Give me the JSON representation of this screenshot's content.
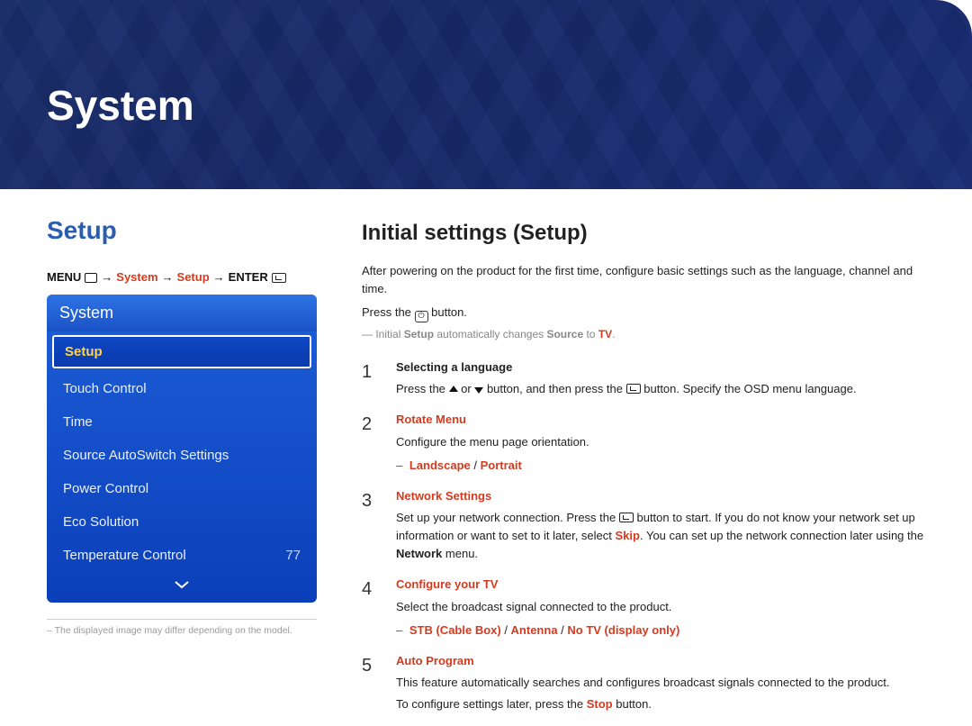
{
  "header": {
    "title": "System"
  },
  "left": {
    "setup_title": "Setup",
    "breadcrumb": {
      "menu": "MENU",
      "arrow": "→",
      "system": "System",
      "setup": "Setup",
      "enter": "ENTER"
    },
    "menu": {
      "title": "System",
      "items": [
        {
          "label": "Setup",
          "selected": true
        },
        {
          "label": "Touch Control"
        },
        {
          "label": "Time"
        },
        {
          "label": "Source AutoSwitch Settings"
        },
        {
          "label": "Power Control"
        },
        {
          "label": "Eco Solution"
        },
        {
          "label": "Temperature Control",
          "value": "77"
        }
      ]
    },
    "footnote_prefix": "– ",
    "footnote": "The displayed image may differ depending on the model."
  },
  "right": {
    "title": "Initial settings (Setup)",
    "intro": "After powering on the product for the first time, configure basic settings such as the language, channel and time.",
    "press_prefix": "Press the ",
    "press_suffix": " button.",
    "dash": "―",
    "dash_note_parts": {
      "t1": "Initial ",
      "setup": "Setup",
      "t2": " automatically changes ",
      "source": "Source",
      "t3": " to ",
      "tv": "TV",
      "t4": "."
    },
    "steps": [
      {
        "num": "1",
        "heading": "Selecting a language",
        "heading_red": false,
        "body_parts": {
          "p1": "Press the ",
          "p2": " or ",
          "p3": " button, and then press the ",
          "p4": " button. Specify the OSD menu language."
        }
      },
      {
        "num": "2",
        "heading": "Rotate Menu",
        "heading_red": true,
        "body": "Configure the menu page orientation.",
        "bullet": {
          "a": "Landscape",
          "sep": " / ",
          "b": "Portrait"
        }
      },
      {
        "num": "3",
        "heading": "Network Settings",
        "heading_red": true,
        "body_parts": {
          "p1": "Set up your network connection. Press the ",
          "p2": " button to start. If you do not know your network set up information or want to set to it later, select ",
          "skip": "Skip",
          "p3": ". You can set up the network connection later using the ",
          "network": "Network",
          "p4": " menu."
        }
      },
      {
        "num": "4",
        "heading": "Configure your TV",
        "heading_red": true,
        "body": "Select the broadcast signal connected to the product.",
        "bullet": {
          "a": "STB (Cable Box)",
          "sep": " / ",
          "b": "Antenna",
          "sep2": " / ",
          "c": "No TV (display only)"
        }
      },
      {
        "num": "5",
        "heading": "Auto Program",
        "heading_red": true,
        "body": "This feature automatically searches and configures broadcast signals connected to the product.",
        "body2_parts": {
          "p1": "To configure settings later, press the ",
          "stop": "Stop",
          "p2": " button."
        }
      }
    ]
  }
}
